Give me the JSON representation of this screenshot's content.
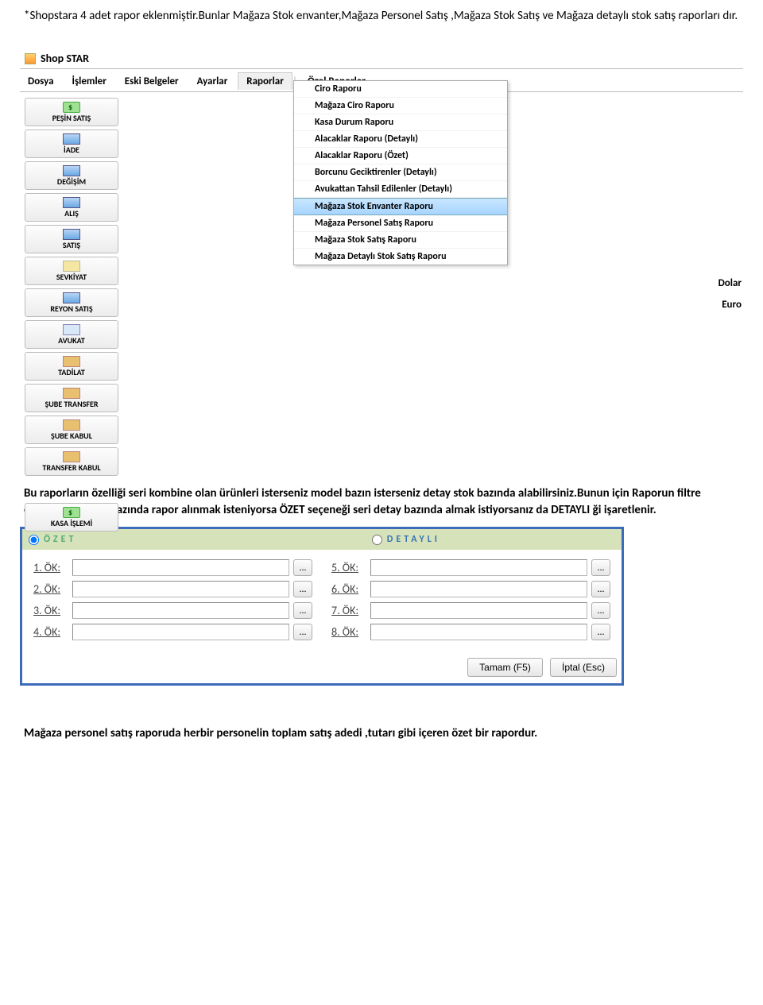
{
  "doc": {
    "intro1": "*Shopstara 4 adet rapor eklenmiştir.Bunlar  Mağaza Stok envanter,Mağaza Personel Satış ,Mağaza Stok Satış ve Mağaza detaylı stok satış raporları dır.",
    "intro2a": "Bu raporların özelliği seri kombine olan ürünleri isterseniz model bazın isterseniz detay stok bazında alabilirsiniz.",
    "intro2b": "Bunun için Raporun filtre ekranında  molde bazında rapor alınmak isteniyorsa  ÖZET seçeneği seri detay bazında almak istiyorsanız da DETAYLI ği işaretlenir.",
    "outro": "Mağaza personel satış raporuda herbir personelin toplam satış adedi ,tutarı gibi içeren özet bir rapordur."
  },
  "app": {
    "title": "Shop STAR",
    "menubar": {
      "items": [
        "Dosya",
        "İşlemler",
        "Eski Belgeler",
        "Ayarlar",
        "Raporlar",
        "Özel Raporlar"
      ],
      "activeIndex": 4
    },
    "sidebar": [
      {
        "label": "PEŞİN SATIŞ",
        "icon": "cash"
      },
      {
        "label": "İADE",
        "icon": "bars"
      },
      {
        "label": "DEĞİŞİM",
        "icon": "bars"
      },
      {
        "label": "ALIŞ",
        "icon": "bars"
      },
      {
        "label": "SATIŞ",
        "icon": "bars"
      },
      {
        "label": "SEVKİYAT",
        "icon": "truck"
      },
      {
        "label": "REYON SATIŞ",
        "icon": "bars"
      },
      {
        "label": "AVUKAT",
        "icon": "card"
      },
      {
        "label": "TADİLAT",
        "icon": "box"
      },
      {
        "label": "ŞUBE TRANSFER",
        "icon": "box"
      },
      {
        "label": "ŞUBE KABUL",
        "icon": "box"
      },
      {
        "label": "TRANSFER KABUL",
        "icon": "box"
      },
      {
        "label": "KASA İŞLEMİ",
        "icon": "cash"
      }
    ],
    "dropdown": {
      "items": [
        "Ciro Raporu",
        "Mağaza Ciro Raporu",
        "Kasa Durum Raporu",
        "Alacaklar Raporu (Detaylı)",
        "Alacaklar Raporu (Özet)",
        "Borcunu Geciktirenler (Detaylı)",
        "Avukattan Tahsil Edilenler (Detaylı)",
        "Mağaza Stok Envanter Raporu",
        "Mağaza Personel Satış Raporu",
        "Mağaza Stok Satış Raporu",
        "Mağaza Detaylı Stok Satış Raporu"
      ],
      "hoverIndex": 7
    },
    "currency": [
      "Dolar",
      "Euro"
    ]
  },
  "filter": {
    "ozet": "ÖZET",
    "detayli": "DETAYLI",
    "ok": [
      "1. ÖK:",
      "2. ÖK:",
      "3. ÖK:",
      "4. ÖK:",
      "5. ÖK:",
      "6. ÖK:",
      "7. ÖK:",
      "8. ÖK:"
    ],
    "dots": "...",
    "tamam": "Tamam (F5)",
    "iptal": "İptal (Esc)"
  }
}
